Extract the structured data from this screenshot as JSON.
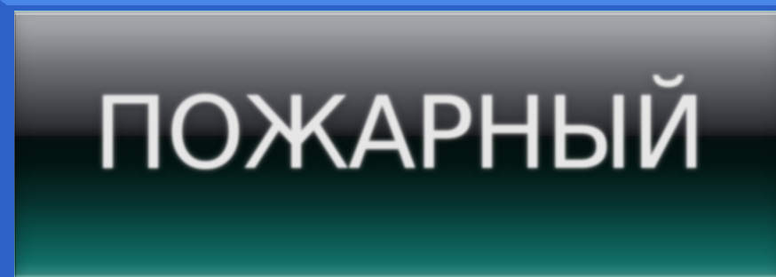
{
  "window": {
    "accent_border_color": "#4a86e8"
  },
  "button": {
    "label": "ПОЖАРНЫЙ",
    "style": "glossy",
    "top_color": "#8f9197",
    "bottom_color": "#126f68"
  }
}
